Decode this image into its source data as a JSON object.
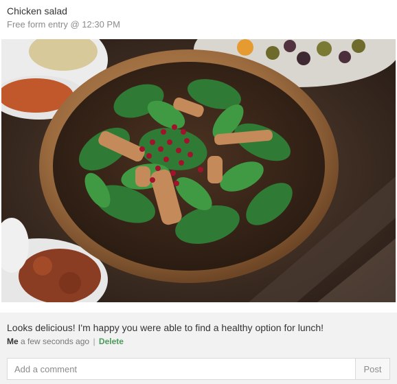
{
  "entry": {
    "title": "Chicken salad",
    "subtitle": "Free form entry @ 12:30 PM"
  },
  "photo": {
    "subject": "salad-bowl-photo"
  },
  "comment": {
    "text": "Looks delicious! I'm happy you were able to find a healthy option for lunch!",
    "author": "Me",
    "time": "a few seconds ago",
    "separator": "|",
    "delete_label": "Delete"
  },
  "composer": {
    "placeholder": "Add a comment",
    "post_label": "Post"
  },
  "colors": {
    "accent_green": "#4a9b5b",
    "comment_bg": "#f2f2f2",
    "muted_text": "#8b8b8b"
  }
}
